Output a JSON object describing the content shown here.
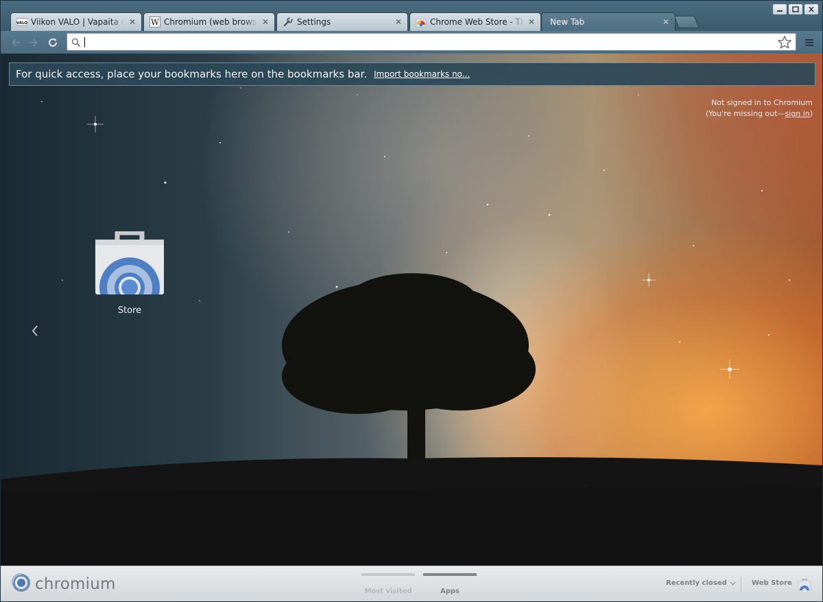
{
  "window": {
    "controls": [
      "minimize",
      "maximize",
      "close"
    ]
  },
  "tabs": [
    {
      "title": "Viikon VALO | Vapaita ohjelmia",
      "favicon": "valo-icon",
      "active": false
    },
    {
      "title": "Chromium (web browser)",
      "favicon": "wikipedia-icon",
      "active": false
    },
    {
      "title": "Settings",
      "favicon": "wrench-icon",
      "active": false
    },
    {
      "title": "Chrome Web Store - Themes",
      "favicon": "webstore-icon",
      "active": false
    },
    {
      "title": "New Tab",
      "favicon": "",
      "active": true
    }
  ],
  "toolbar": {
    "omnibox_value": ""
  },
  "bookmarks_bar": {
    "message": "For quick access, place your bookmarks here on the bookmarks bar.",
    "import_link": "Import bookmarks no..."
  },
  "signin": {
    "line1": "Not signed in to Chromium",
    "line2_prefix": "(You're missing out—",
    "link": "sign in",
    "line2_suffix": ")"
  },
  "apps": [
    {
      "label": "Store",
      "icon": "web-store-icon"
    }
  ],
  "footer": {
    "brand": "chromium",
    "pages": [
      {
        "label": "Most visited",
        "active": false
      },
      {
        "label": "Apps",
        "active": true
      }
    ],
    "recently_closed": "Recently closed",
    "web_store": "Web Store"
  },
  "colors": {
    "frame": "#4b6c80",
    "active_tab": "#587a8e",
    "bookmark_bar_bg": "#2b4858"
  }
}
